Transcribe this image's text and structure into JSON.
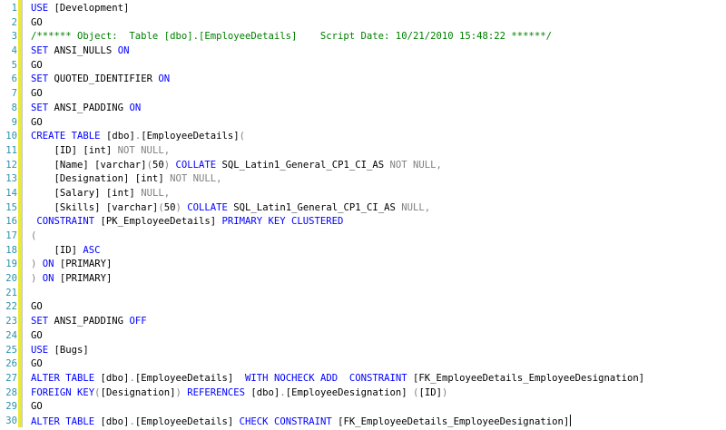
{
  "colors": {
    "keyword": "#0000ff",
    "comment": "#008000",
    "operator": "#808080",
    "function": "#ff00ff",
    "line_number": "#2b91af",
    "change_bar": "#e8e83a"
  },
  "lines": [
    {
      "n": "1",
      "tokens": [
        {
          "t": "USE",
          "c": "kw"
        },
        {
          "t": " [Development]",
          "c": ""
        }
      ]
    },
    {
      "n": "2",
      "tokens": [
        {
          "t": "GO",
          "c": ""
        }
      ]
    },
    {
      "n": "3",
      "tokens": [
        {
          "t": "/****** Object:  Table [dbo].[EmployeeDetails]    Script Date: 10/21/2010 15:48:22 ******/",
          "c": "cm"
        }
      ]
    },
    {
      "n": "4",
      "tokens": [
        {
          "t": "SET",
          "c": "kw"
        },
        {
          "t": " ANSI_NULLS ",
          "c": ""
        },
        {
          "t": "ON",
          "c": "kw"
        }
      ]
    },
    {
      "n": "5",
      "tokens": [
        {
          "t": "GO",
          "c": ""
        }
      ]
    },
    {
      "n": "6",
      "tokens": [
        {
          "t": "SET",
          "c": "kw"
        },
        {
          "t": " QUOTED_IDENTIFIER ",
          "c": ""
        },
        {
          "t": "ON",
          "c": "kw"
        }
      ]
    },
    {
      "n": "7",
      "tokens": [
        {
          "t": "GO",
          "c": ""
        }
      ]
    },
    {
      "n": "8",
      "tokens": [
        {
          "t": "SET",
          "c": "kw"
        },
        {
          "t": " ANSI_PADDING ",
          "c": ""
        },
        {
          "t": "ON",
          "c": "kw"
        }
      ]
    },
    {
      "n": "9",
      "tokens": [
        {
          "t": "GO",
          "c": ""
        }
      ]
    },
    {
      "n": "10",
      "tokens": [
        {
          "t": "CREATE",
          "c": "kw"
        },
        {
          "t": " ",
          "c": ""
        },
        {
          "t": "TABLE",
          "c": "kw"
        },
        {
          "t": " [dbo]",
          "c": ""
        },
        {
          "t": ".",
          "c": "gr"
        },
        {
          "t": "[EmployeeDetails]",
          "c": ""
        },
        {
          "t": "(",
          "c": "gr"
        }
      ]
    },
    {
      "n": "11",
      "tokens": [
        {
          "t": "    [ID] [int] ",
          "c": ""
        },
        {
          "t": "NOT NULL",
          "c": "gr"
        },
        {
          "t": ",",
          "c": "gr"
        }
      ]
    },
    {
      "n": "12",
      "tokens": [
        {
          "t": "    [Name] [varchar]",
          "c": ""
        },
        {
          "t": "(",
          "c": "gr"
        },
        {
          "t": "50",
          "c": ""
        },
        {
          "t": ")",
          "c": "gr"
        },
        {
          "t": " ",
          "c": ""
        },
        {
          "t": "COLLATE",
          "c": "kw"
        },
        {
          "t": " SQL_Latin1_General_CP1_CI_AS ",
          "c": ""
        },
        {
          "t": "NOT NULL",
          "c": "gr"
        },
        {
          "t": ",",
          "c": "gr"
        }
      ]
    },
    {
      "n": "13",
      "tokens": [
        {
          "t": "    [Designation] [int] ",
          "c": ""
        },
        {
          "t": "NOT NULL",
          "c": "gr"
        },
        {
          "t": ",",
          "c": "gr"
        }
      ]
    },
    {
      "n": "14",
      "tokens": [
        {
          "t": "    [Salary] [int] ",
          "c": ""
        },
        {
          "t": "NULL",
          "c": "gr"
        },
        {
          "t": ",",
          "c": "gr"
        }
      ]
    },
    {
      "n": "15",
      "tokens": [
        {
          "t": "    [Skills] [varchar]",
          "c": ""
        },
        {
          "t": "(",
          "c": "gr"
        },
        {
          "t": "50",
          "c": ""
        },
        {
          "t": ")",
          "c": "gr"
        },
        {
          "t": " ",
          "c": ""
        },
        {
          "t": "COLLATE",
          "c": "kw"
        },
        {
          "t": " SQL_Latin1_General_CP1_CI_AS ",
          "c": ""
        },
        {
          "t": "NULL",
          "c": "gr"
        },
        {
          "t": ",",
          "c": "gr"
        }
      ]
    },
    {
      "n": "16",
      "tokens": [
        {
          "t": " ",
          "c": ""
        },
        {
          "t": "CONSTRAINT",
          "c": "kw"
        },
        {
          "t": " [PK_EmployeeDetails] ",
          "c": ""
        },
        {
          "t": "PRIMARY KEY CLUSTERED",
          "c": "kw"
        }
      ]
    },
    {
      "n": "17",
      "tokens": [
        {
          "t": "(",
          "c": "gr"
        }
      ]
    },
    {
      "n": "18",
      "tokens": [
        {
          "t": "    [ID] ",
          "c": ""
        },
        {
          "t": "ASC",
          "c": "kw"
        }
      ]
    },
    {
      "n": "19",
      "tokens": [
        {
          "t": ")",
          "c": "gr"
        },
        {
          "t": " ",
          "c": ""
        },
        {
          "t": "ON",
          "c": "kw"
        },
        {
          "t": " [PRIMARY]",
          "c": ""
        }
      ]
    },
    {
      "n": "20",
      "tokens": [
        {
          "t": ")",
          "c": "gr"
        },
        {
          "t": " ",
          "c": ""
        },
        {
          "t": "ON",
          "c": "kw"
        },
        {
          "t": " [PRIMARY]",
          "c": ""
        }
      ]
    },
    {
      "n": "21",
      "tokens": []
    },
    {
      "n": "22",
      "tokens": [
        {
          "t": "GO",
          "c": ""
        }
      ]
    },
    {
      "n": "23",
      "tokens": [
        {
          "t": "SET",
          "c": "kw"
        },
        {
          "t": " ANSI_PADDING ",
          "c": ""
        },
        {
          "t": "OFF",
          "c": "kw"
        }
      ]
    },
    {
      "n": "24",
      "tokens": [
        {
          "t": "GO",
          "c": ""
        }
      ]
    },
    {
      "n": "25",
      "tokens": [
        {
          "t": "USE",
          "c": "kw"
        },
        {
          "t": " [Bugs]",
          "c": ""
        }
      ]
    },
    {
      "n": "26",
      "tokens": [
        {
          "t": "GO",
          "c": ""
        }
      ]
    },
    {
      "n": "27",
      "tokens": [
        {
          "t": "ALTER",
          "c": "kw"
        },
        {
          "t": " ",
          "c": ""
        },
        {
          "t": "TABLE",
          "c": "kw"
        },
        {
          "t": " [dbo]",
          "c": ""
        },
        {
          "t": ".",
          "c": "gr"
        },
        {
          "t": "[EmployeeDetails]  ",
          "c": ""
        },
        {
          "t": "WITH",
          "c": "kw"
        },
        {
          "t": " ",
          "c": ""
        },
        {
          "t": "NOCHECK",
          "c": "kw"
        },
        {
          "t": " ",
          "c": ""
        },
        {
          "t": "ADD",
          "c": "kw"
        },
        {
          "t": "  ",
          "c": ""
        },
        {
          "t": "CONSTRAINT",
          "c": "kw"
        },
        {
          "t": " [FK_EmployeeDetails_EmployeeDesignation]",
          "c": ""
        }
      ]
    },
    {
      "n": "28",
      "tokens": [
        {
          "t": "FOREIGN KEY",
          "c": "kw"
        },
        {
          "t": "(",
          "c": "gr"
        },
        {
          "t": "[Designation]",
          "c": ""
        },
        {
          "t": ")",
          "c": "gr"
        },
        {
          "t": " ",
          "c": ""
        },
        {
          "t": "REFERENCES",
          "c": "kw"
        },
        {
          "t": " [dbo]",
          "c": ""
        },
        {
          "t": ".",
          "c": "gr"
        },
        {
          "t": "[EmployeeDesignation] ",
          "c": ""
        },
        {
          "t": "(",
          "c": "gr"
        },
        {
          "t": "[ID]",
          "c": ""
        },
        {
          "t": ")",
          "c": "gr"
        }
      ]
    },
    {
      "n": "29",
      "tokens": [
        {
          "t": "GO",
          "c": ""
        }
      ]
    },
    {
      "n": "30",
      "tokens": [
        {
          "t": "ALTER",
          "c": "kw"
        },
        {
          "t": " ",
          "c": ""
        },
        {
          "t": "TABLE",
          "c": "kw"
        },
        {
          "t": " [dbo]",
          "c": ""
        },
        {
          "t": ".",
          "c": "gr"
        },
        {
          "t": "[EmployeeDetails] ",
          "c": ""
        },
        {
          "t": "CHECK",
          "c": "kw"
        },
        {
          "t": " ",
          "c": ""
        },
        {
          "t": "CONSTRAINT",
          "c": "kw"
        },
        {
          "t": " [FK_EmployeeDetails_EmployeeDesignation]",
          "c": ""
        }
      ],
      "caret": true
    }
  ]
}
